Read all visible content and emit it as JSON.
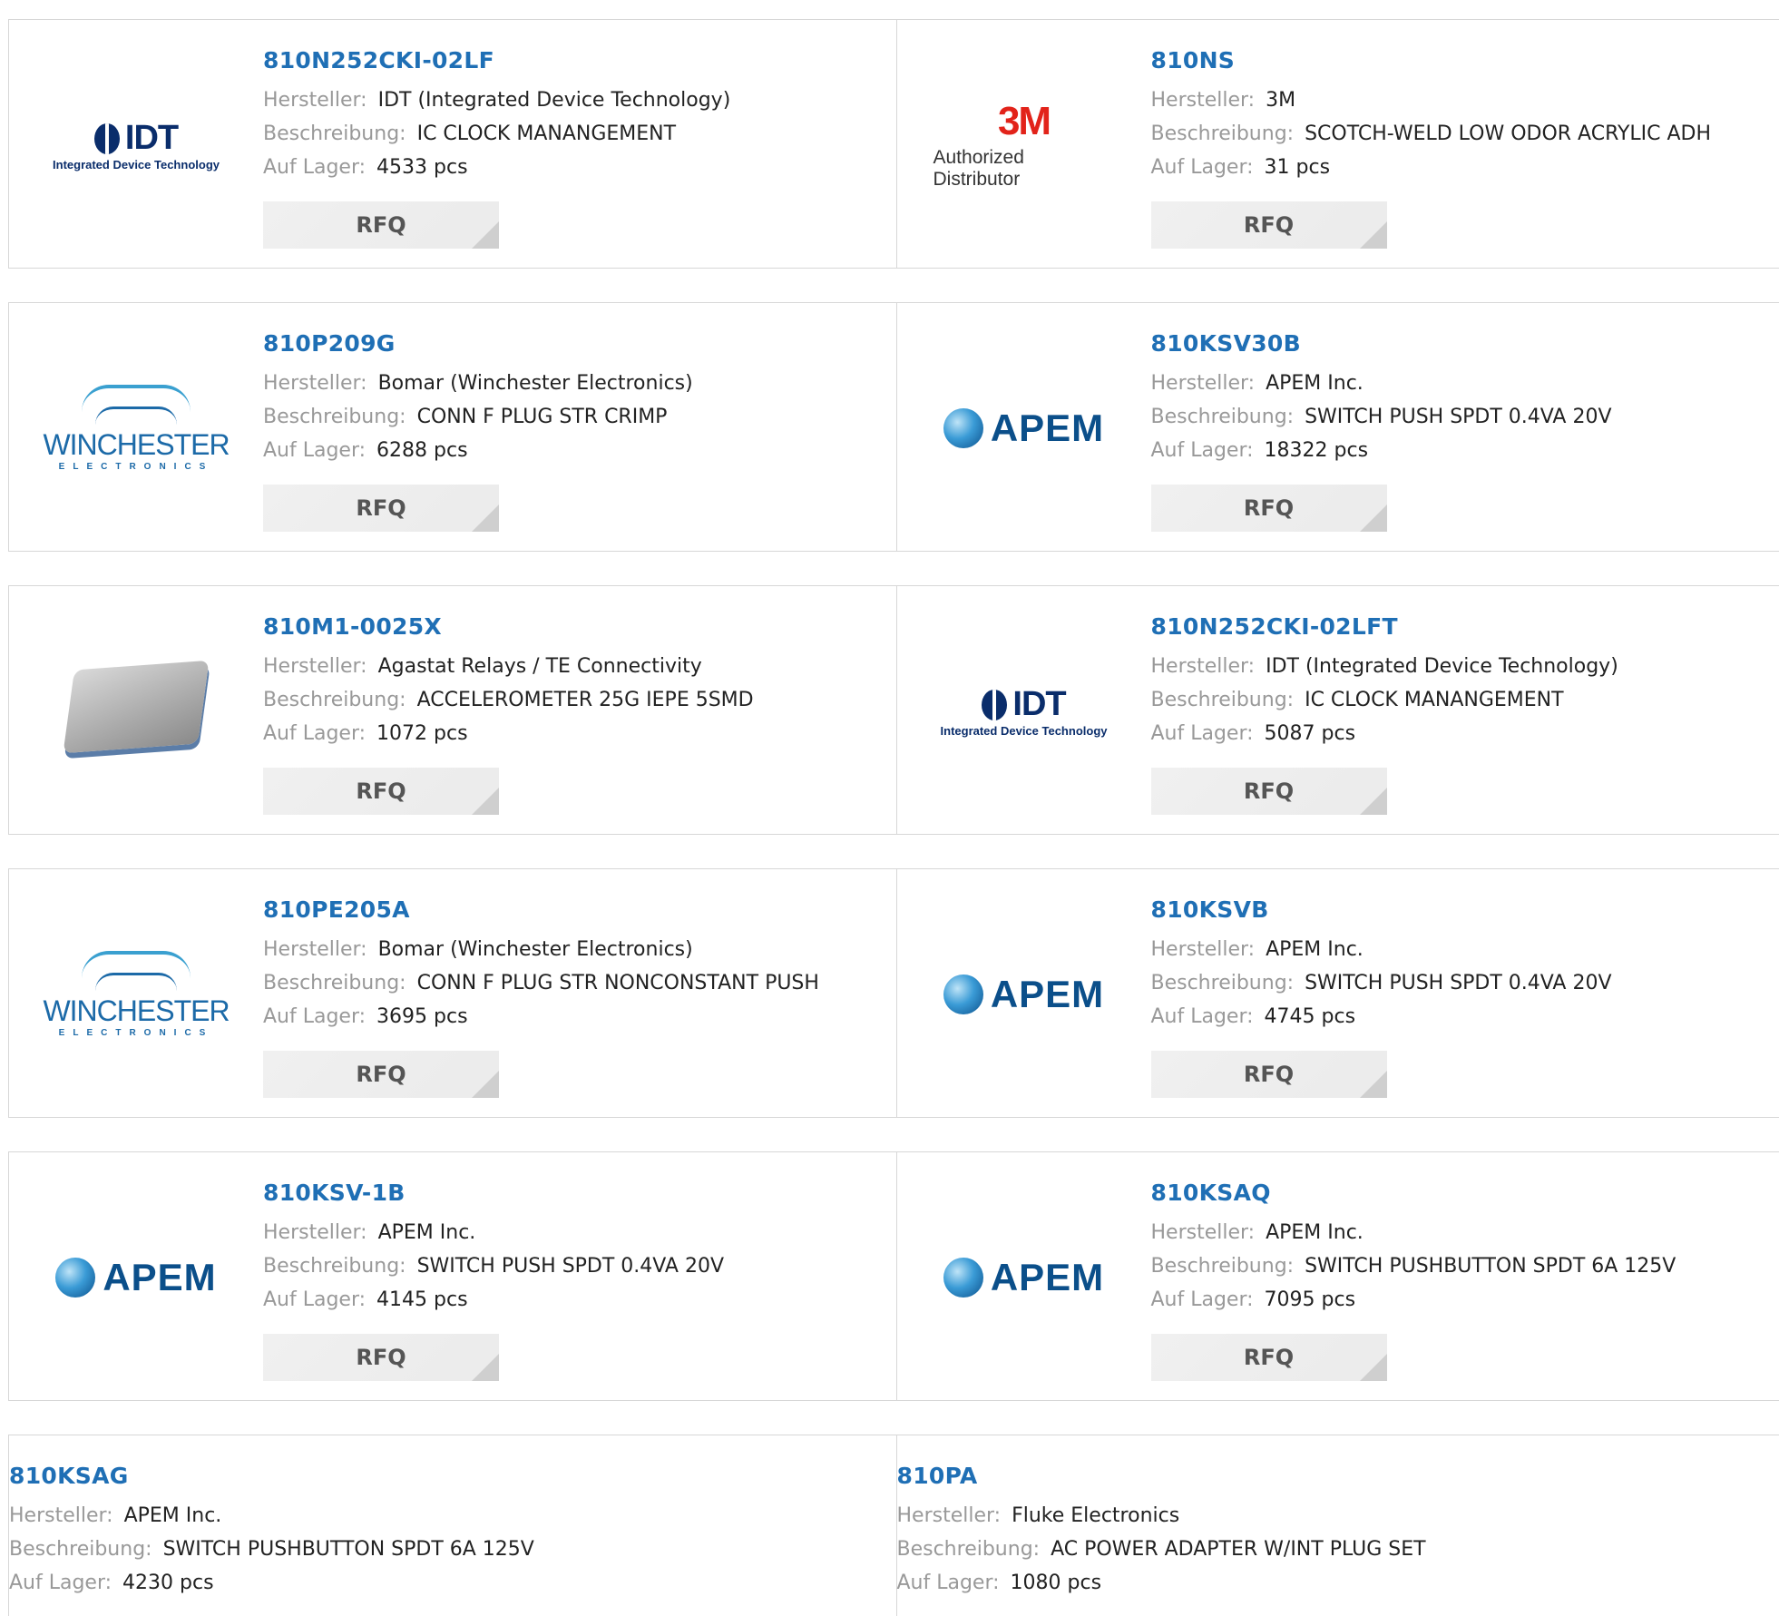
{
  "labels": {
    "hersteller": "Hersteller:",
    "beschreibung": "Beschreibung:",
    "auf_lager": "Auf Lager:",
    "rfq": "RFQ"
  },
  "products": [
    {
      "pn": "810N252CKI-02LF",
      "mfr": "IDT (Integrated Device Technology)",
      "desc": "IC CLOCK MANANGEMENT",
      "stock": "4533 pcs",
      "logo": "idt-logo",
      "logo_text": "IDT",
      "logo_sub": "Integrated Device Technology"
    },
    {
      "pn": "810NS",
      "mfr": "3M",
      "desc": "SCOTCH-WELD LOW ODOR ACRYLIC ADH",
      "stock": "31 pcs",
      "logo": "3m-logo",
      "logo_text": "3M",
      "logo_sub": "Authorized Distributor"
    },
    {
      "pn": "810P209G",
      "mfr": "Bomar (Winchester Electronics)",
      "desc": "CONN F PLUG STR CRIMP",
      "stock": "6288 pcs",
      "logo": "winchester-logo",
      "logo_text": "WINCHESTER",
      "logo_sub": "ELECTRONICS"
    },
    {
      "pn": "810KSV30B",
      "mfr": "APEM Inc.",
      "desc": "SWITCH PUSH SPDT 0.4VA 20V",
      "stock": "18322 pcs",
      "logo": "apem-logo",
      "logo_text": "APEM"
    },
    {
      "pn": "810M1-0025X",
      "mfr": "Agastat Relays / TE Connectivity",
      "desc": "ACCELEROMETER 25G IEPE 5SMD",
      "stock": "1072 pcs",
      "logo": "product-image"
    },
    {
      "pn": "810N252CKI-02LFT",
      "mfr": "IDT (Integrated Device Technology)",
      "desc": "IC CLOCK MANANGEMENT",
      "stock": "5087 pcs",
      "logo": "idt-logo",
      "logo_text": "IDT",
      "logo_sub": "Integrated Device Technology"
    },
    {
      "pn": "810PE205A",
      "mfr": "Bomar (Winchester Electronics)",
      "desc": "CONN F PLUG STR NONCONSTANT PUSH",
      "stock": "3695 pcs",
      "logo": "winchester-logo",
      "logo_text": "WINCHESTER",
      "logo_sub": "ELECTRONICS"
    },
    {
      "pn": "810KSVB",
      "mfr": "APEM Inc.",
      "desc": "SWITCH PUSH SPDT 0.4VA 20V",
      "stock": "4745 pcs",
      "logo": "apem-logo",
      "logo_text": "APEM"
    },
    {
      "pn": "810KSV-1B",
      "mfr": "APEM Inc.",
      "desc": "SWITCH PUSH SPDT 0.4VA 20V",
      "stock": "4145 pcs",
      "logo": "apem-logo",
      "logo_text": "APEM"
    },
    {
      "pn": "810KSAQ",
      "mfr": "APEM Inc.",
      "desc": "SWITCH PUSHBUTTON SPDT 6A 125V",
      "stock": "7095 pcs",
      "logo": "apem-logo",
      "logo_text": "APEM"
    },
    {
      "pn": "810KSAG",
      "mfr": "APEM Inc.",
      "desc": "SWITCH PUSHBUTTON SPDT 6A 125V",
      "stock": "4230 pcs"
    },
    {
      "pn": "810PA",
      "mfr": "Fluke Electronics",
      "desc": "AC POWER ADAPTER W/INT PLUG SET",
      "stock": "1080 pcs"
    }
  ],
  "colors": {
    "link": "#1f6fb5",
    "label": "#999999",
    "border": "#d7d7d7",
    "rfq_bg": "#efefef"
  }
}
